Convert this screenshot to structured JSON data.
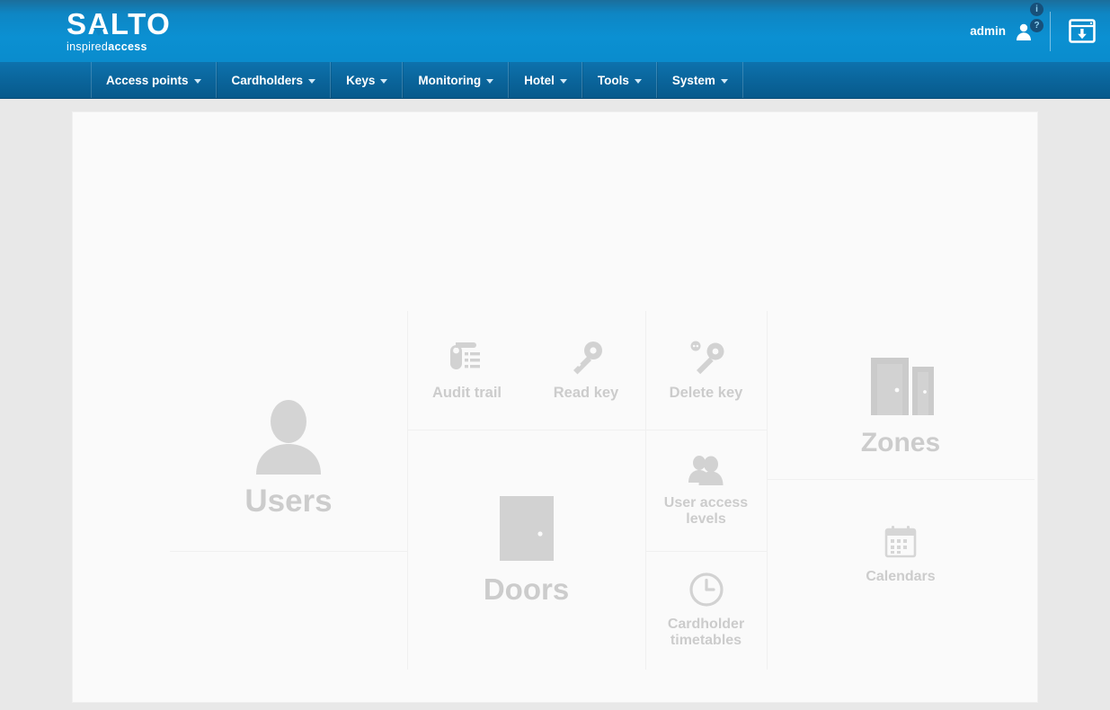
{
  "brand": {
    "name_a": "S",
    "name_tri": "A",
    "name_b": "LTO",
    "tagline_light": "inspired",
    "tagline_bold": "access"
  },
  "header": {
    "user_label": "admin",
    "user_icon": "person-icon",
    "download_icon": "window-download-icon",
    "info_badge": "i",
    "help_badge": "?"
  },
  "nav": {
    "items": [
      {
        "label": "Access points",
        "icon": "chevron-down-icon"
      },
      {
        "label": "Cardholders",
        "icon": "chevron-down-icon"
      },
      {
        "label": "Keys",
        "icon": "chevron-down-icon"
      },
      {
        "label": "Monitoring",
        "icon": "chevron-down-icon"
      },
      {
        "label": "Hotel",
        "icon": "chevron-down-icon"
      },
      {
        "label": "Tools",
        "icon": "chevron-down-icon"
      },
      {
        "label": "System",
        "icon": "chevron-down-icon"
      }
    ]
  },
  "dashboard": {
    "tiles": [
      {
        "label": "Users",
        "icon": "user-silhouette-icon"
      },
      {
        "label": "Audit trail",
        "icon": "door-handle-list-icon"
      },
      {
        "label": "Read key",
        "icon": "key-icon"
      },
      {
        "label": "Delete key",
        "icon": "key-delete-icon"
      },
      {
        "label": "Doors",
        "icon": "door-icon"
      },
      {
        "label": "User access levels",
        "icon": "two-people-icon"
      },
      {
        "label": "Cardholder timetables",
        "icon": "clock-icon"
      },
      {
        "label": "Zones",
        "icon": "two-doors-icon"
      },
      {
        "label": "Calendars",
        "icon": "calendar-icon"
      }
    ]
  },
  "colors": {
    "header_blue": "#0b90d2",
    "nav_blue": "#0a649a",
    "page_bg": "#e8e8e8",
    "panel_bg": "#fafafa",
    "tile_gray": "#cccccc"
  }
}
